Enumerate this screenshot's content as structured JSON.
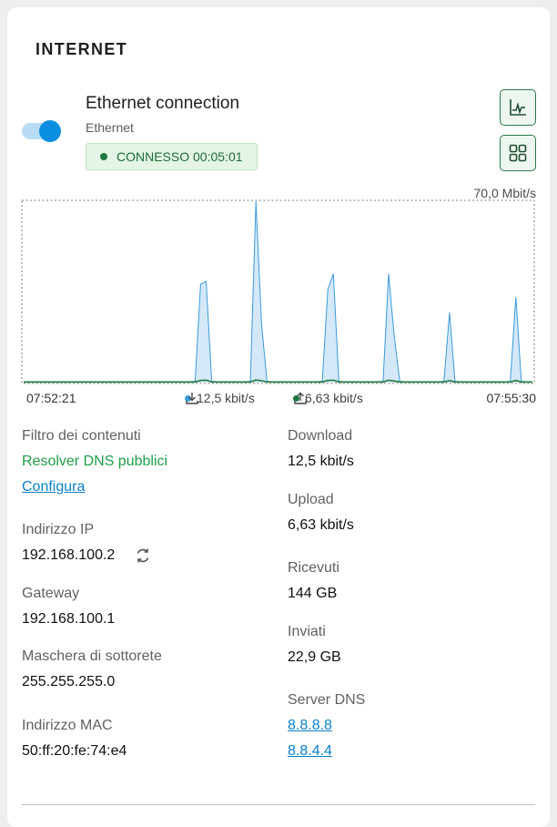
{
  "card": {
    "title": "INTERNET"
  },
  "connection": {
    "name": "Ethernet connection",
    "type": "Ethernet",
    "status": "CONNESSO 00:05:01",
    "enabled": true
  },
  "chart_data": {
    "type": "area",
    "ymax_label": "70,0 Mbit/s",
    "ylim": [
      0,
      70
    ],
    "x_start": "07:52:21",
    "x_end": "07:55:30",
    "series": [
      {
        "name": "12,5 kbit/s",
        "color": "#3a9bd9",
        "fill": "#cfe6f7",
        "values": [
          0.3,
          0.3,
          0.3,
          0.3,
          0.3,
          0.3,
          0.3,
          0.3,
          0.3,
          0.3,
          0.3,
          0.3,
          0.3,
          0.3,
          0.3,
          0.3,
          0.3,
          0.3,
          0.3,
          0.3,
          0.3,
          0.3,
          0.3,
          0.3,
          0.3,
          0.3,
          0.3,
          0.3,
          0.3,
          0.3,
          0.3,
          0.5,
          38,
          39,
          0.5,
          0.3,
          0.3,
          0.3,
          0.3,
          0.3,
          0.3,
          0.5,
          70,
          23,
          0.5,
          0.3,
          0.3,
          0.3,
          0.3,
          0.3,
          0.3,
          0.3,
          0.3,
          0.3,
          0.5,
          36,
          42,
          0.5,
          0.3,
          0.3,
          0.3,
          0.3,
          0.3,
          0.3,
          0.3,
          0.5,
          42,
          18,
          0.5,
          0.3,
          0.3,
          0.3,
          0.3,
          0.3,
          0.3,
          0.3,
          0.5,
          27,
          0.5,
          0.3,
          0.3,
          0.3,
          0.3,
          0.3,
          0.3,
          0.3,
          0.3,
          0.3,
          0.5,
          33,
          0.5,
          0.3,
          0.3
        ]
      },
      {
        "name": "6,63 kbit/s",
        "color": "#1f7a3e",
        "values": [
          0.2,
          0.2,
          0.2,
          0.2,
          0.2,
          0.2,
          0.2,
          0.2,
          0.2,
          0.2,
          0.2,
          0.2,
          0.2,
          0.2,
          0.2,
          0.2,
          0.2,
          0.2,
          0.2,
          0.2,
          0.2,
          0.2,
          0.2,
          0.2,
          0.2,
          0.2,
          0.2,
          0.2,
          0.2,
          0.2,
          0.2,
          0.2,
          0.8,
          0.9,
          0.2,
          0.2,
          0.2,
          0.2,
          0.2,
          0.2,
          0.2,
          0.2,
          1.0,
          0.7,
          0.2,
          0.2,
          0.2,
          0.2,
          0.2,
          0.2,
          0.2,
          0.2,
          0.2,
          0.2,
          0.2,
          0.8,
          0.9,
          0.2,
          0.2,
          0.2,
          0.2,
          0.2,
          0.2,
          0.2,
          0.2,
          0.2,
          0.9,
          0.6,
          0.2,
          0.2,
          0.2,
          0.2,
          0.2,
          0.2,
          0.2,
          0.2,
          0.2,
          0.7,
          0.2,
          0.2,
          0.2,
          0.2,
          0.2,
          0.2,
          0.2,
          0.2,
          0.2,
          0.2,
          0.2,
          0.8,
          0.2,
          0.2,
          0.2
        ]
      }
    ]
  },
  "left_info": {
    "content_filter": {
      "label": "Filtro dei contenuti",
      "value": "Resolver DNS pubblici",
      "link": "Configura"
    },
    "ip": {
      "label": "Indirizzo IP",
      "value": "192.168.100.2"
    },
    "gateway": {
      "label": "Gateway",
      "value": "192.168.100.1"
    },
    "netmask": {
      "label": "Maschera di sottorete",
      "value": "255.255.255.0"
    },
    "mac": {
      "label": "Indirizzo MAC",
      "value": "50:ff:20:fe:74:e4"
    }
  },
  "right_info": {
    "download": {
      "label": "Download",
      "value": "12,5 kbit/s"
    },
    "upload": {
      "label": "Upload",
      "value": "6,63 kbit/s"
    },
    "received": {
      "label": "Ricevuti",
      "value": "144 GB"
    },
    "sent": {
      "label": "Inviati",
      "value": "22,9 GB"
    },
    "dns": {
      "label": "Server DNS",
      "servers": [
        "8.8.8.8",
        "8.8.4.4"
      ]
    }
  },
  "icons": {
    "chart_button": "chart-line-icon",
    "grid_button": "grid-icon",
    "refresh": "refresh-icon",
    "download": "download-icon",
    "upload": "upload-icon"
  },
  "colors": {
    "accent": "#0a8fe0",
    "success": "#1d7a3c",
    "link": "#0b7fc8",
    "green_text": "#1e9e47"
  }
}
